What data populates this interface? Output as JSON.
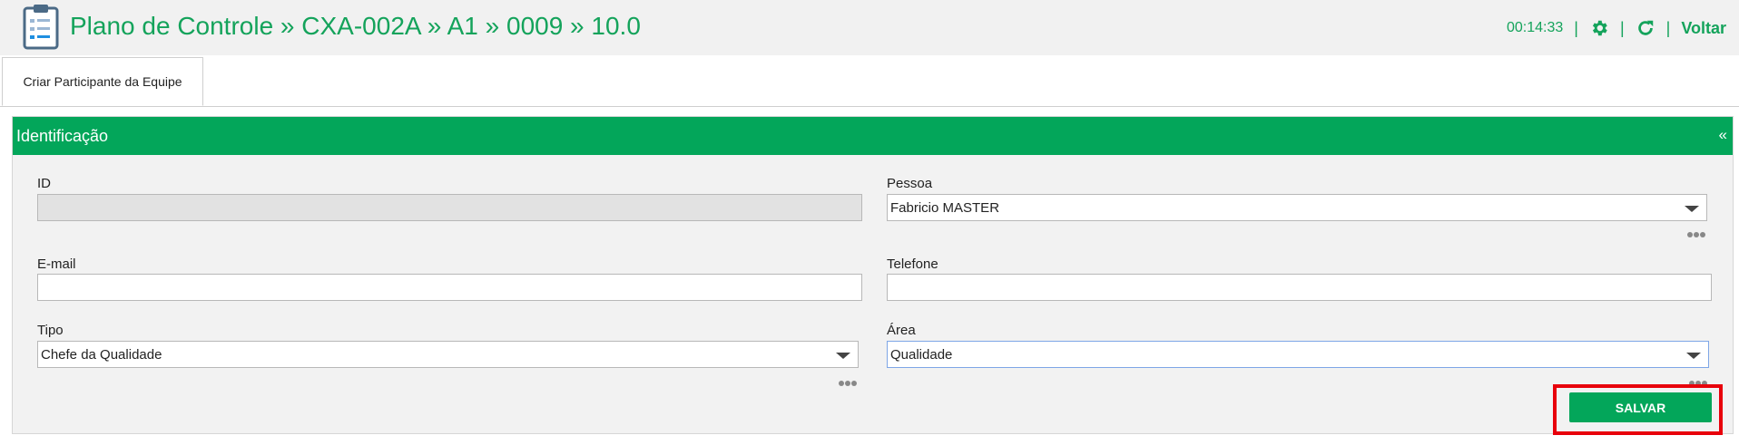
{
  "header": {
    "title": "Plano de Controle » CXA-002A » A1 » 0009 » 10.0",
    "clock": "00:14:33",
    "separator": "|",
    "back_label": "Voltar",
    "accent_color": "#14a35b",
    "icons": [
      "clipboard-icon",
      "gear-icon",
      "refresh-icon"
    ]
  },
  "tabs": [
    {
      "label": "Criar Participante da Equipe",
      "active": true
    }
  ],
  "panel": {
    "title": "Identificação",
    "collapse_label": "«",
    "header_color": "#03a65a"
  },
  "form": {
    "id": {
      "label": "ID",
      "value": ""
    },
    "pessoa": {
      "label": "Pessoa",
      "value": "Fabricio MASTER"
    },
    "email": {
      "label": "E-mail",
      "value": ""
    },
    "telefone": {
      "label": "Telefone",
      "value": ""
    },
    "tipo": {
      "label": "Tipo",
      "value": "Chefe da Qualidade"
    },
    "area": {
      "label": "Área",
      "value": "Qualidade"
    }
  },
  "actions": {
    "save_label": "SALVAR",
    "highlight_color": "#e8000b"
  }
}
